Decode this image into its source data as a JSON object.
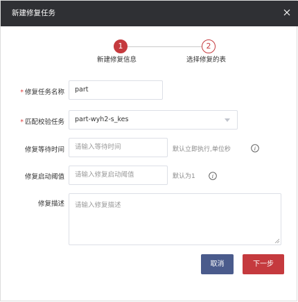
{
  "dialog": {
    "title": "新建修复任务",
    "close_icon": "close-icon"
  },
  "steps": [
    {
      "number": "1",
      "label": "新建修复信息",
      "active": true
    },
    {
      "number": "2",
      "label": "选择修复的表",
      "active": false
    }
  ],
  "form": {
    "task_name": {
      "label": "修复任务名称",
      "required": "*",
      "value": "part"
    },
    "check_task": {
      "label": "匹配校验任务",
      "required": "*",
      "value": "part-wyh2-s_kes"
    },
    "wait_time": {
      "label": "修复等待时间",
      "placeholder": "请输入等待时间",
      "hint": "默认立即执行,单位秒"
    },
    "threshold": {
      "label": "修复启动阈值",
      "placeholder": "请输入修复启动阈值",
      "hint": "默认为1"
    },
    "description": {
      "label": "修复描述",
      "placeholder": "请输入修复描述"
    }
  },
  "buttons": {
    "cancel": "取消",
    "next": "下一步"
  },
  "colors": {
    "header_bg": "#2f3034",
    "accent": "#c53a3e",
    "cancel_bg": "#4a5b8c"
  }
}
